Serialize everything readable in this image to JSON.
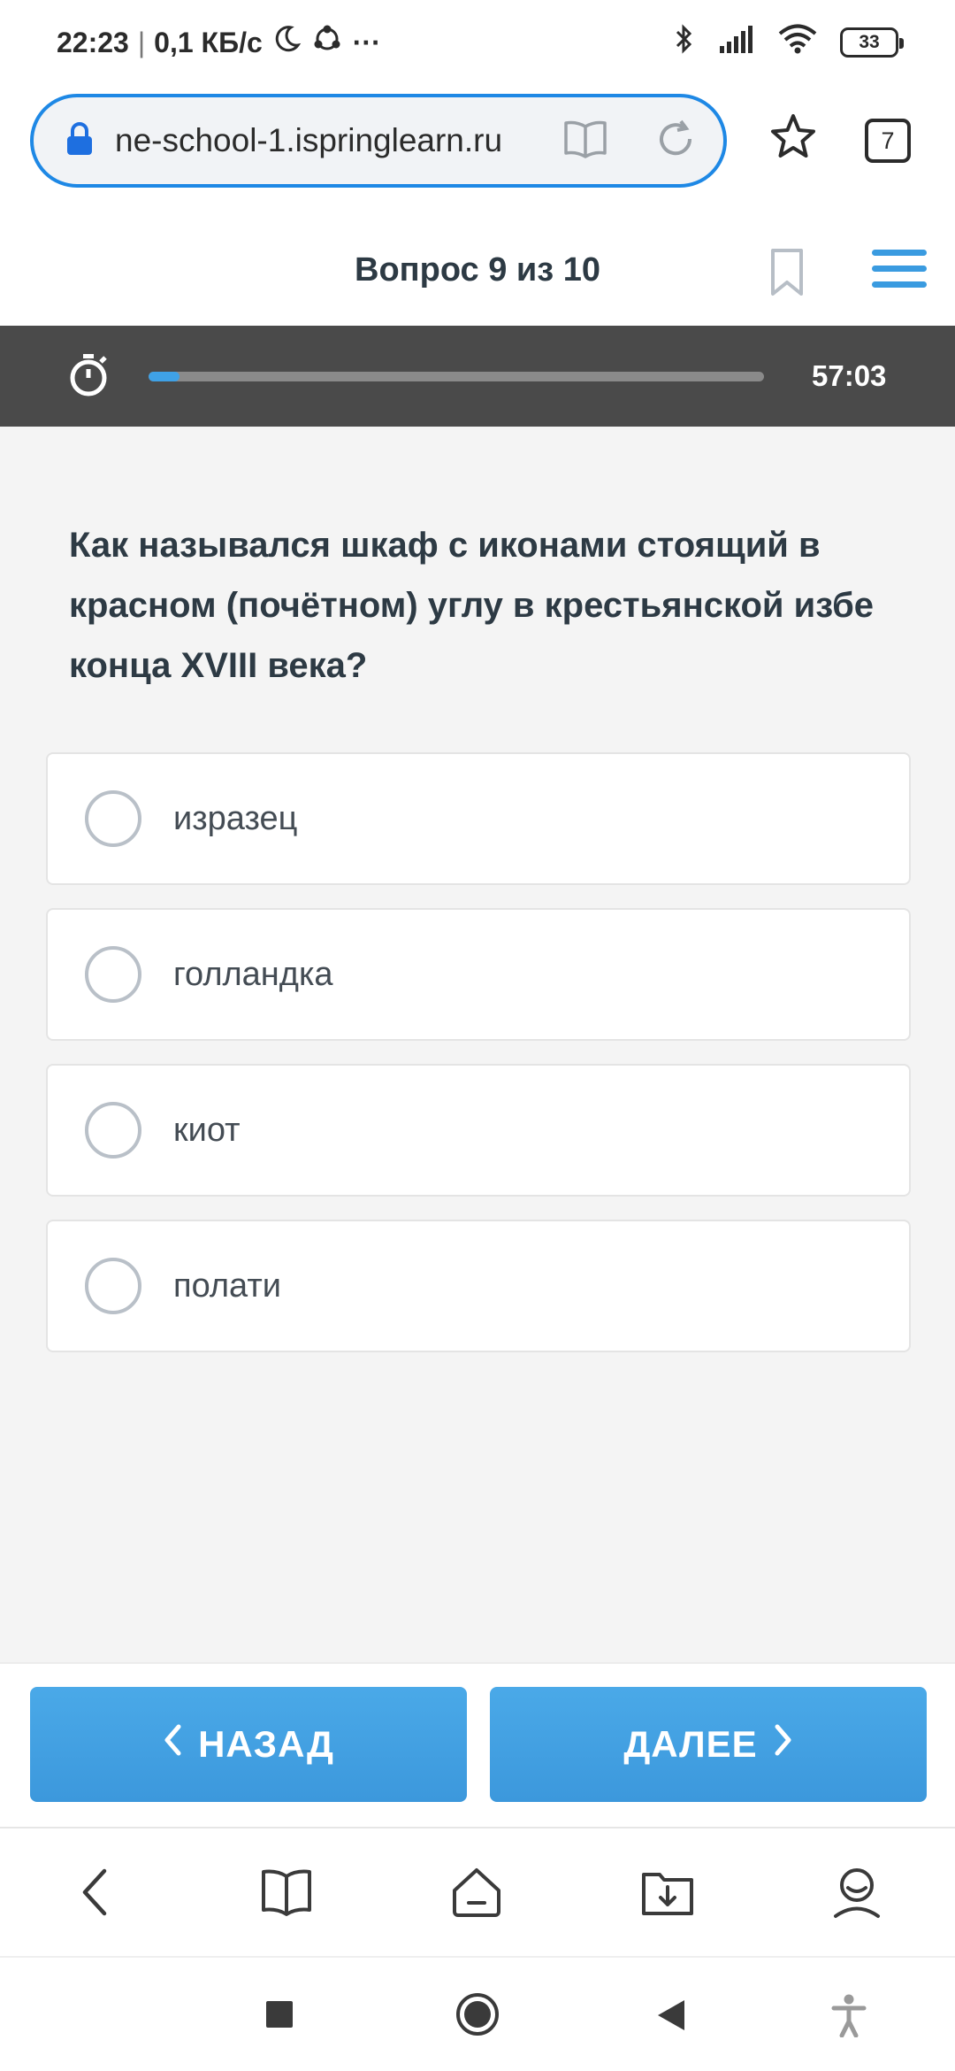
{
  "status_bar": {
    "time": "22:23",
    "separator": "|",
    "network_speed": "0,1 КБ/с",
    "more": "···",
    "battery": "33"
  },
  "browser": {
    "url": "ne-school-1.ispringlearn.ru",
    "tab_count": "7"
  },
  "quiz": {
    "counter": "Вопрос 9 из 10",
    "timer": "57:03",
    "progress_fraction": 0.05,
    "question": "Как назывался шкаф с иконами стоящий в красном (почётном) углу в крестьянской избе конца XVIII века?",
    "options": [
      "изразец",
      "голландка",
      "киот",
      "полати"
    ]
  },
  "nav": {
    "back_label": "НАЗАД",
    "next_label": "ДАЛЕЕ"
  },
  "colors": {
    "accent": "#3fa1e6",
    "timer_bar": "#4a4a4a",
    "content_bg": "#f4f4f4",
    "url_border": "#1e88e5"
  },
  "icons": {
    "status": [
      "moon-icon",
      "sync-icon",
      "bluetooth-icon",
      "signal-icon",
      "wifi-icon",
      "battery-icon"
    ],
    "browser": [
      "lock-icon",
      "reader-icon",
      "reload-icon",
      "star-icon",
      "tabs-icon"
    ],
    "quiz": [
      "bookmark-icon",
      "menu-icon",
      "stopwatch-icon",
      "radio-icon"
    ],
    "toolbar": [
      "back-arrow-icon",
      "bookmarks-book-icon",
      "home-icon",
      "downloads-icon",
      "profile-icon"
    ],
    "system": [
      "recents-square-icon",
      "home-circle-icon",
      "back-triangle-icon",
      "accessibility-icon"
    ]
  }
}
